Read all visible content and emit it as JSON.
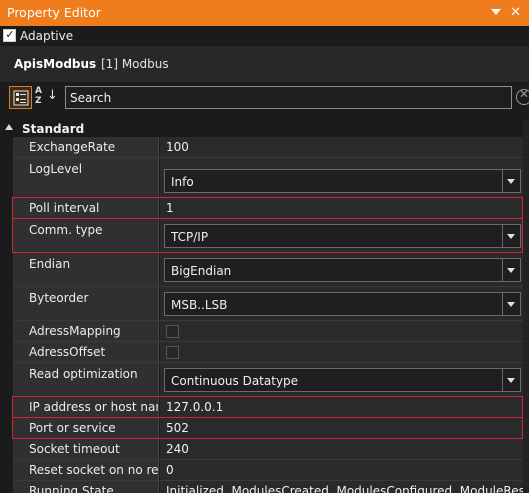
{
  "window": {
    "title": "Property Editor"
  },
  "adaptive": {
    "label": "Adaptive",
    "checked": true,
    "check_glyph": "✓"
  },
  "object": {
    "name": "ApisModbus",
    "type": "[1] Modbus"
  },
  "toolbar": {
    "search_text": "Search",
    "sort_label": "A\nZ"
  },
  "category": {
    "title": "Standard"
  },
  "properties": [
    {
      "name": "ExchangeRate",
      "value": "100",
      "kind": "text"
    },
    {
      "name": "LogLevel",
      "value": "Info",
      "kind": "combo"
    },
    {
      "name": "Poll interval",
      "value": "1",
      "kind": "text",
      "highlighted": true
    },
    {
      "name": "Comm. type",
      "value": "TCP/IP",
      "kind": "combo",
      "highlighted": true
    },
    {
      "name": "Endian",
      "value": "BigEndian",
      "kind": "combo"
    },
    {
      "name": "Byteorder",
      "value": "MSB..LSB",
      "kind": "combo"
    },
    {
      "name": "AdressMapping",
      "value": "",
      "kind": "checkbox"
    },
    {
      "name": "AdressOffset",
      "value": "",
      "kind": "checkbox"
    },
    {
      "name": "Read optimization",
      "value": "Continuous  Datatype",
      "kind": "combo"
    },
    {
      "name": "IP address or host name",
      "value": "127.0.0.1",
      "kind": "text",
      "highlighted": true
    },
    {
      "name": "Port or service",
      "value": "502",
      "kind": "text",
      "highlighted": true
    },
    {
      "name": "Socket timeout",
      "value": "240",
      "kind": "text"
    },
    {
      "name": "Reset socket on no res...",
      "value": "0",
      "kind": "text"
    },
    {
      "name": "Running State",
      "value": "Initialized, ModulesCreated, ModulesConfigured, ModuleResourcesA",
      "kind": "text"
    }
  ],
  "colors": {
    "accent": "#ef7d1d",
    "highlight": "#d0243a"
  }
}
